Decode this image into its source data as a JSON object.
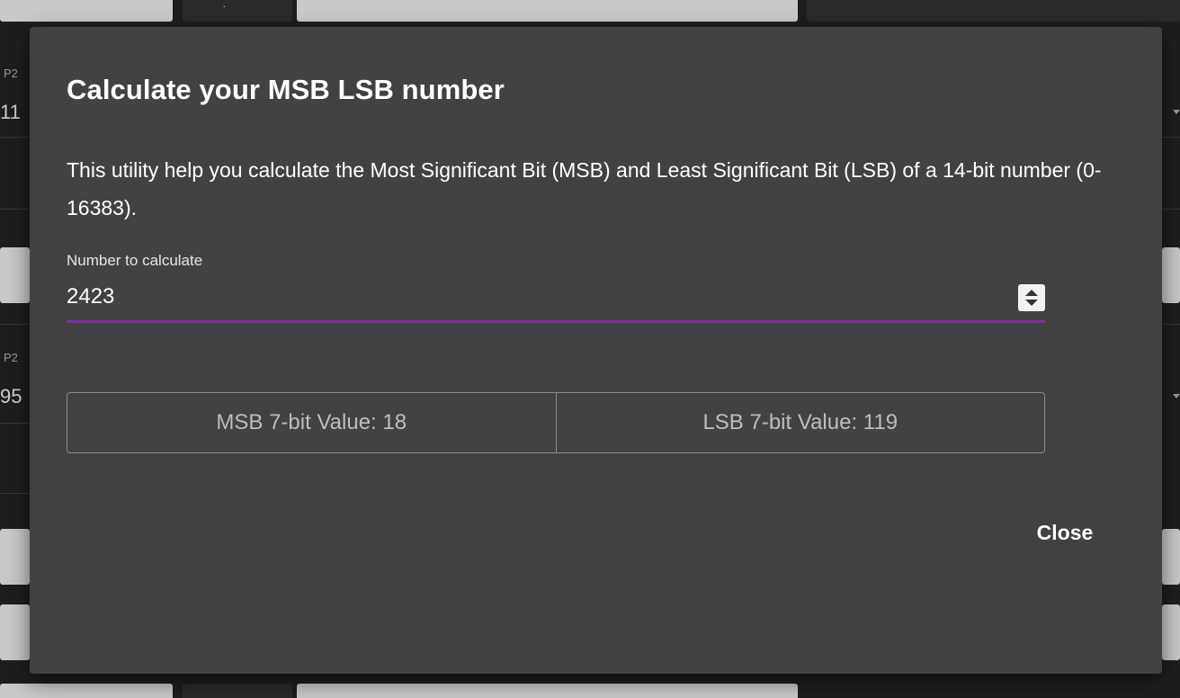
{
  "background": {
    "left_values": [
      "11",
      "95"
    ],
    "left_labels": [
      "P2",
      "P2"
    ]
  },
  "dialog": {
    "title": "Calculate your MSB LSB number",
    "description": "This utility help you calculate the Most Significant Bit (MSB) and Least Significant Bit (LSB) of a 14-bit number (0-16383).",
    "number_field": {
      "label": "Number to calculate",
      "value": "2423"
    },
    "results": {
      "msb": "MSB 7-bit Value: 18",
      "lsb": "LSB 7-bit Value: 119"
    },
    "close_label": "Close"
  },
  "colors": {
    "dialog_bg": "#424242",
    "accent_underline": "#7b2fa6",
    "backdrop": "#1e1e1e"
  },
  "icons": {
    "stepper": "number-stepper-icon"
  }
}
